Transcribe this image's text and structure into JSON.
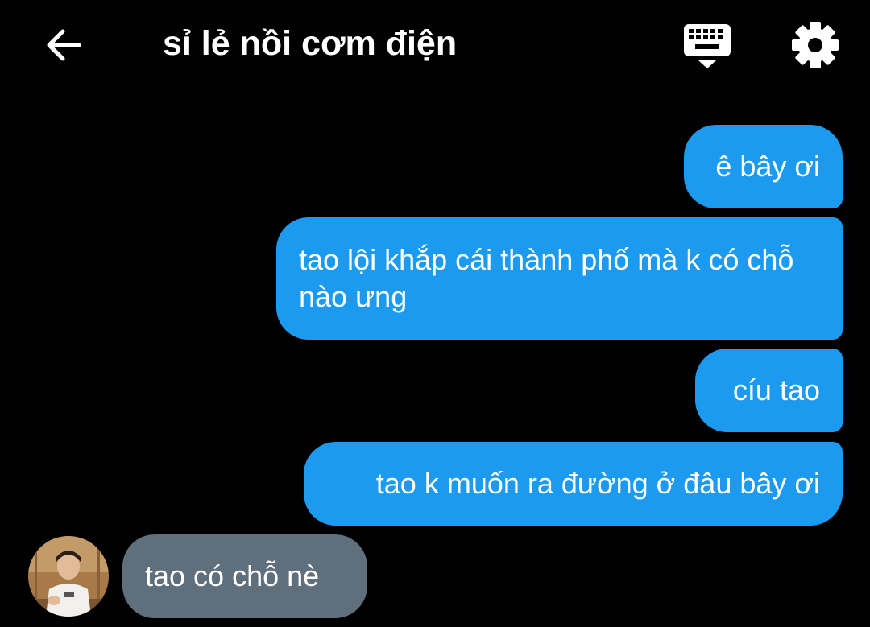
{
  "header": {
    "title": "sỉ lẻ nồi cơm điện",
    "back_icon": "arrow-left-icon",
    "keyboard_icon": "keyboard-hide-icon",
    "settings_icon": "gear-icon"
  },
  "messages": [
    {
      "direction": "outgoing",
      "text": "ê bây ơi"
    },
    {
      "direction": "outgoing",
      "text": "tao lội khắp cái thành phố mà k có chỗ nào ưng"
    },
    {
      "direction": "outgoing",
      "text": "cíu tao"
    },
    {
      "direction": "outgoing",
      "text": "tao k muốn ra đường ở đâu bây ơi"
    },
    {
      "direction": "incoming",
      "text": "tao có chỗ nè"
    }
  ],
  "colors": {
    "background": "#000000",
    "outgoing_bubble": "#1b9af0",
    "incoming_bubble": "#5f6f7c",
    "text": "#ffffff"
  }
}
